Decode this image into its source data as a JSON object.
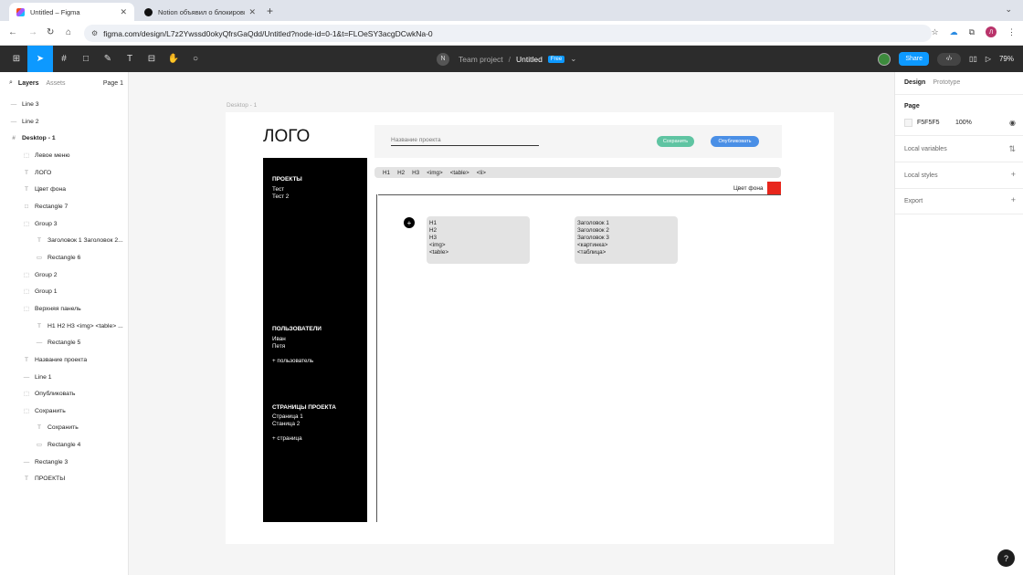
{
  "browser": {
    "tabs": [
      {
        "title": "Untitled – Figma",
        "active": true
      },
      {
        "title": "Notion объявил о блокировке",
        "active": false
      }
    ],
    "new_tab": "+",
    "url": "figma.com/design/L7z2Ywssd0okyQfrsGaQdd/Untitled?node-id=0-1&t=FLOeSY3acgDCwkNa-0",
    "profile_initial": "Л"
  },
  "toolbar": {
    "project_initial": "N",
    "team": "Team project",
    "separator": "/",
    "file_name": "Untitled",
    "plan_badge": "Free",
    "share_label": "Share",
    "zoom": "79%"
  },
  "left_panel": {
    "tab_layers": "Layers",
    "tab_assets": "Assets",
    "page_selector": "Page 1",
    "layers": [
      {
        "name": "Line 3",
        "icon": "—"
      },
      {
        "name": "Line 2",
        "icon": "—"
      },
      {
        "name": "Desktop - 1",
        "icon": "#"
      },
      {
        "name": "Левое меню",
        "icon": "⬚"
      },
      {
        "name": "ЛОГО",
        "icon": "T"
      },
      {
        "name": "Цвет фона",
        "icon": "T"
      },
      {
        "name": "Rectangle 7",
        "icon": "□"
      },
      {
        "name": "Group 3",
        "icon": "⬚"
      },
      {
        "name": "Заголовок 1 Заголовок 2...",
        "icon": "T"
      },
      {
        "name": "Rectangle 6",
        "icon": "▭"
      },
      {
        "name": "Group 2",
        "icon": "⬚"
      },
      {
        "name": "Group 1",
        "icon": "⬚"
      },
      {
        "name": "Верхняя панель",
        "icon": "⬚"
      },
      {
        "name": "H1 H2 H3 <img> <table> ...",
        "icon": "T"
      },
      {
        "name": "Rectangle 5",
        "icon": "—"
      },
      {
        "name": "Название проекта",
        "icon": "T"
      },
      {
        "name": "Line 1",
        "icon": "—"
      },
      {
        "name": "Опубликовать",
        "icon": "⬚"
      },
      {
        "name": "Сохранить",
        "icon": "⬚"
      },
      {
        "name": "Сохранить",
        "icon": "T"
      },
      {
        "name": "Rectangle 4",
        "icon": "▭"
      },
      {
        "name": "Rectangle 3",
        "icon": "—"
      },
      {
        "name": "ПРОЕКТЫ",
        "icon": "T"
      }
    ]
  },
  "canvas": {
    "frame_label": "Desktop - 1",
    "logo": "ЛОГО",
    "sidebar": {
      "projects_heading": "ПРОЕКТЫ",
      "projects_items": "Тест\nТест 2",
      "users_heading": "ПОЛЬЗОВАТЕЛИ",
      "users_items": "Иван\nПетя",
      "add_user": "+ пользователь",
      "pages_heading": "СТРАНИЦЫ ПРОЕКТА",
      "pages_items": "Страница 1\nСтаница 2",
      "add_page": "+ страница"
    },
    "project_name_placeholder": "Название проекта",
    "save_button": "Сохранить",
    "publish_button": "Опубликовать",
    "tool_strip": [
      "H1",
      "H2",
      "H3",
      "<img>",
      "<table>",
      "<li>"
    ],
    "bg_color_label": "Цвет фона",
    "plus": "+",
    "menu_left": "H1\nH2\nH3\n<img>\n<table>",
    "menu_right": "Заголовок 1\nЗаголовок 2\nЗаголовок 3\n<картинка>\n<таблица>"
  },
  "right_panel": {
    "tab_design": "Design",
    "tab_prototype": "Prototype",
    "page_heading": "Page",
    "page_color": "F5F5F5",
    "page_opacity": "100%",
    "local_variables": "Local variables",
    "local_styles": "Local styles",
    "export": "Export"
  },
  "help": "?",
  "colors": {
    "accent": "#0d99ff",
    "save_button": "#5fc4a2",
    "publish_button": "#4a8fe6",
    "bg_swatch": "#e8261c"
  }
}
